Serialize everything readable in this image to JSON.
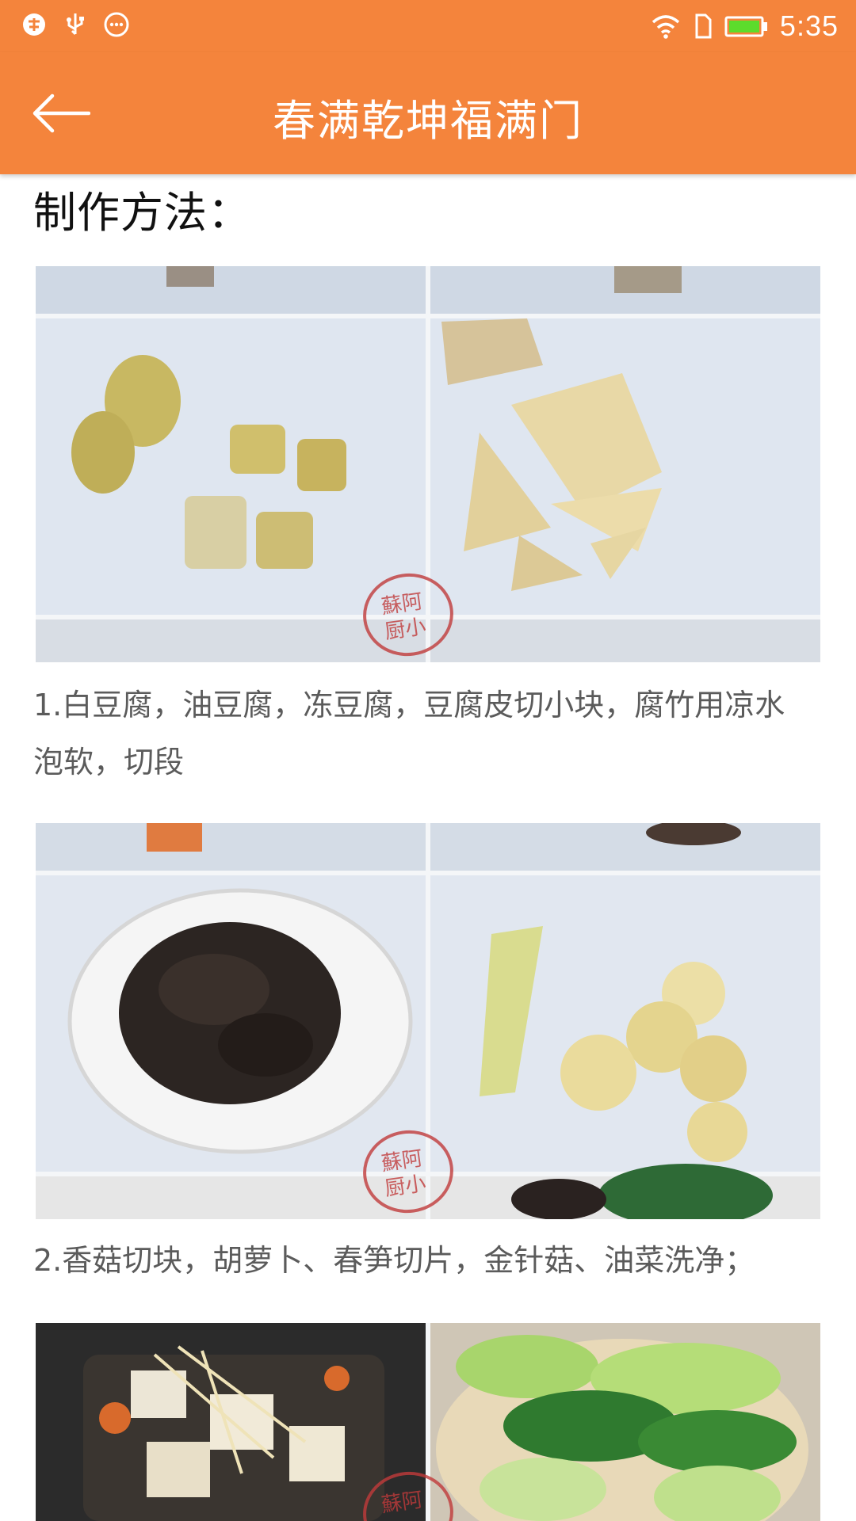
{
  "status_bar": {
    "time": "5:35",
    "left_icons": [
      "notification-icon",
      "usb-icon",
      "more-icon"
    ],
    "right_icons": [
      "wifi-icon",
      "sim-icon",
      "battery-icon"
    ]
  },
  "app_bar": {
    "title": "春满乾坤福满门",
    "back_icon": "arrow-left-icon",
    "background": "#f4843c"
  },
  "content": {
    "heading": "制作方法：",
    "steps": [
      {
        "text": "1.白豆腐，油豆腐，冻豆腐，豆腐皮切小块，腐竹用凉水泡软，切段"
      },
      {
        "text": "2.香菇切块，胡萝卜、春笋切片，金针菇、油菜洗净；"
      },
      {
        "text": ""
      }
    ]
  }
}
